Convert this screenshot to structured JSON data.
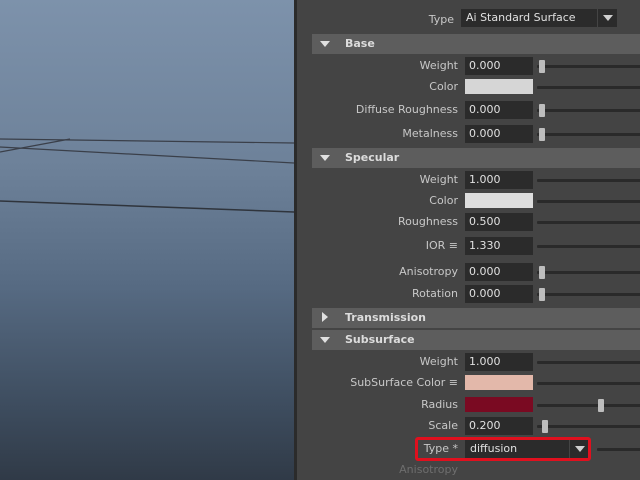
{
  "type_row": {
    "label": "Type",
    "value": "Ai Standard Surface"
  },
  "sections": {
    "base": "Base",
    "specular": "Specular",
    "transmission": "Transmission",
    "subsurface": "Subsurface"
  },
  "base": {
    "weight": {
      "label": "Weight",
      "value": "0.000"
    },
    "color": {
      "label": "Color",
      "swatch": "#d6d6d6"
    },
    "diffuse_roughness": {
      "label": "Diffuse Roughness",
      "value": "0.000"
    },
    "metalness": {
      "label": "Metalness",
      "value": "0.000"
    }
  },
  "specular": {
    "weight": {
      "label": "Weight",
      "value": "1.000"
    },
    "color": {
      "label": "Color",
      "swatch": "#dedede"
    },
    "roughness": {
      "label": "Roughness",
      "value": "0.500"
    },
    "ior": {
      "label": "IOR ≡",
      "value": "1.330"
    },
    "anisotropy": {
      "label": "Anisotropy",
      "value": "0.000"
    },
    "rotation": {
      "label": "Rotation",
      "value": "0.000"
    }
  },
  "subsurface": {
    "weight": {
      "label": "Weight",
      "value": "1.000"
    },
    "subsurface_color": {
      "label": "SubSurface Color ≡",
      "swatch": "#e3b8aa"
    },
    "radius": {
      "label": "Radius",
      "swatch": "#7a0a22"
    },
    "scale": {
      "label": "Scale",
      "value": "0.200"
    },
    "type": {
      "label": "Type *",
      "value": "diffusion"
    },
    "anisotropy": {
      "label": "Anisotropy"
    }
  },
  "colors": {
    "highlight": "#e0101e"
  }
}
